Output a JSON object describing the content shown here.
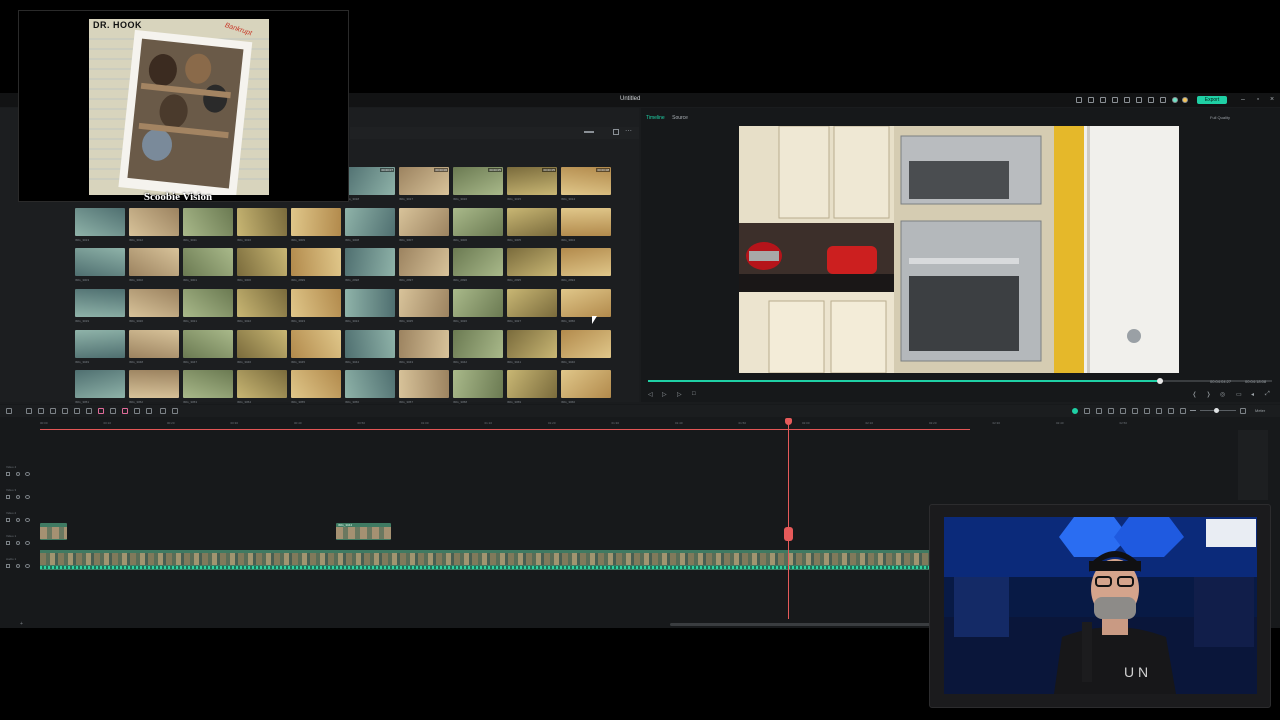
{
  "app": {
    "title": "Untitled",
    "export_label": "Export",
    "accent": "#1fd0a5",
    "playhead_color": "#e65a5a"
  },
  "player": {
    "tabs": [
      "Timeline",
      "Source"
    ],
    "quality": "Full Quality",
    "current_time": "00:04:04:27",
    "total_time": "00:04:18:08",
    "progress": 0.82
  },
  "media": {
    "thumbnails": [
      {
        "label": "IMG_3018",
        "dur": "00:00:07"
      },
      {
        "label": "IMG_3017",
        "dur": "00:00:06"
      },
      {
        "label": "IMG_3016",
        "dur": "00:00:05"
      },
      {
        "label": "IMG_3015",
        "dur": "00:00:05"
      },
      {
        "label": "IMG_3014",
        "dur": "00:00:08"
      },
      {
        "label": "IMG_3013",
        "dur": ""
      },
      {
        "label": "IMG_3012",
        "dur": ""
      },
      {
        "label": "IMG_3011",
        "dur": ""
      },
      {
        "label": "IMG_3010",
        "dur": ""
      },
      {
        "label": "IMG_3009",
        "dur": ""
      },
      {
        "label": "IMG_3008",
        "dur": ""
      },
      {
        "label": "IMG_3007",
        "dur": ""
      },
      {
        "label": "IMG_3006",
        "dur": ""
      },
      {
        "label": "IMG_3005",
        "dur": ""
      },
      {
        "label": "IMG_3004",
        "dur": ""
      },
      {
        "label": "IMG_3003",
        "dur": ""
      },
      {
        "label": "IMG_3002",
        "dur": ""
      },
      {
        "label": "IMG_3001",
        "dur": ""
      },
      {
        "label": "IMG_3000",
        "dur": ""
      },
      {
        "label": "IMG_2999",
        "dur": ""
      },
      {
        "label": "IMG_2998",
        "dur": ""
      },
      {
        "label": "IMG_2997",
        "dur": ""
      },
      {
        "label": "IMG_2996",
        "dur": ""
      },
      {
        "label": "IMG_2995",
        "dur": ""
      },
      {
        "label": "IMG_2994",
        "dur": ""
      },
      {
        "label": "IMG_3019",
        "dur": ""
      },
      {
        "label": "IMG_3020",
        "dur": ""
      },
      {
        "label": "IMG_3021",
        "dur": ""
      },
      {
        "label": "IMG_3022",
        "dur": ""
      },
      {
        "label": "IMG_3023",
        "dur": ""
      },
      {
        "label": "IMG_3024",
        "dur": ""
      },
      {
        "label": "IMG_3025",
        "dur": ""
      },
      {
        "label": "IMG_3026",
        "dur": ""
      },
      {
        "label": "IMG_3027",
        "dur": ""
      },
      {
        "label": "IMG_3050",
        "dur": ""
      },
      {
        "label": "IMG_3049",
        "dur": ""
      },
      {
        "label": "IMG_3048",
        "dur": ""
      },
      {
        "label": "IMG_3047",
        "dur": ""
      },
      {
        "label": "IMG_3046",
        "dur": ""
      },
      {
        "label": "IMG_3045",
        "dur": ""
      },
      {
        "label": "IMG_3044",
        "dur": ""
      },
      {
        "label": "IMG_3043",
        "dur": ""
      },
      {
        "label": "IMG_3042",
        "dur": ""
      },
      {
        "label": "IMG_3041",
        "dur": ""
      },
      {
        "label": "IMG_3040",
        "dur": ""
      },
      {
        "label": "IMG_3051",
        "dur": ""
      },
      {
        "label": "IMG_3052",
        "dur": ""
      },
      {
        "label": "IMG_3053",
        "dur": ""
      },
      {
        "label": "IMG_3054",
        "dur": ""
      },
      {
        "label": "IMG_3055",
        "dur": ""
      },
      {
        "label": "IMG_3056",
        "dur": ""
      },
      {
        "label": "IMG_3057",
        "dur": ""
      },
      {
        "label": "IMG_3058",
        "dur": ""
      },
      {
        "label": "IMG_3059",
        "dur": ""
      },
      {
        "label": "IMG_3060",
        "dur": ""
      }
    ]
  },
  "timeline": {
    "tick_labels": [
      "00:00",
      "00:10",
      "00:20",
      "00:30",
      "00:40",
      "00:50",
      "01:00",
      "01:10",
      "01:20",
      "01:30",
      "01:40",
      "01:50",
      "02:00",
      "02:10",
      "02:20",
      "02:30",
      "02:40",
      "02:50"
    ],
    "tracks": [
      "Video 4",
      "Video 3",
      "Video 2",
      "Video 1",
      "Audio 1"
    ],
    "clip_label": "IMG_3044",
    "meter_label": "Meter"
  },
  "overlay_album": {
    "band": "DR. HOOK",
    "album": "Bankrupt",
    "caption": "Scoobie Vision"
  }
}
